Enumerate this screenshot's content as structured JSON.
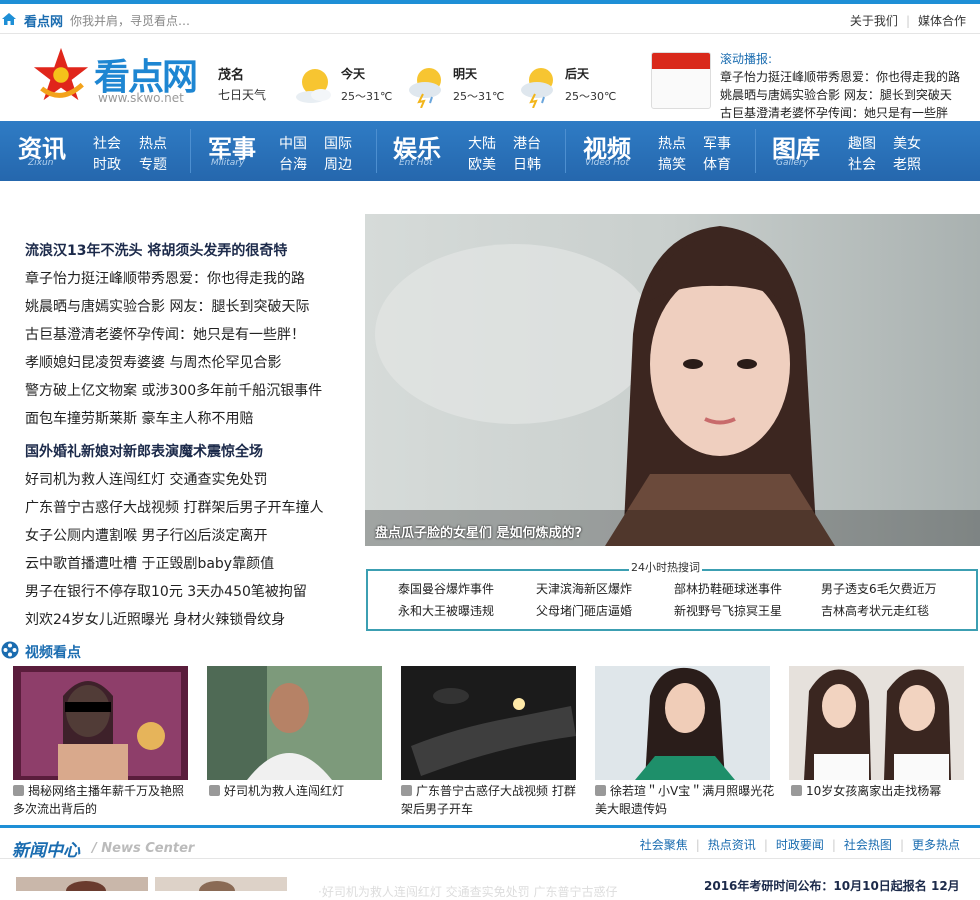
{
  "topbar": {
    "site_name": "看点网",
    "slogan": "你我并肩，寻觅看点…",
    "about": "关于我们",
    "media": "媒体合作"
  },
  "header": {
    "logo_text": "看点网",
    "logo_url": "www.skwo.net",
    "city": "茂名",
    "city_sub": "七日天气",
    "weather": [
      {
        "day": "今天",
        "temp": "25～31℃",
        "icon": "sunny-cloud-icon"
      },
      {
        "day": "明天",
        "temp": "25～31℃",
        "icon": "thunder-rain-icon"
      },
      {
        "day": "后天",
        "temp": "25～30℃",
        "icon": "thunder-rain-icon"
      }
    ],
    "scroll_title": "滚动播报:",
    "scroll_items": [
      "章子怡力挺汪峰顺带秀恩爱：你也得走我的路",
      "姚晨晒与唐嫣实验合影 网友：腿长到突破天",
      "古巨基澄清老婆怀孕传闻：她只是有一些胖"
    ]
  },
  "nav": [
    {
      "big": "资讯",
      "en": "Zixun",
      "subs": [
        [
          "社会",
          "热点"
        ],
        [
          "时政",
          "专题"
        ]
      ]
    },
    {
      "big": "军事",
      "en": "Military",
      "subs": [
        [
          "中国",
          "国际"
        ],
        [
          "台海",
          "周边"
        ]
      ]
    },
    {
      "big": "娱乐",
      "en": "Ent Hot",
      "subs": [
        [
          "大陆",
          "港台"
        ],
        [
          "欧美",
          "日韩"
        ]
      ]
    },
    {
      "big": "视频",
      "en": "Video Hot",
      "subs": [
        [
          "热点",
          "军事"
        ],
        [
          "搞笑",
          "体育"
        ]
      ]
    },
    {
      "big": "图库",
      "en": "Gallery",
      "subs": [
        [
          "趣图",
          "美女"
        ],
        [
          "社会",
          "老照"
        ]
      ]
    }
  ],
  "headlines": [
    {
      "text": "流浪汉13年不洗头 将胡须头发弄的很奇特",
      "bold": true
    },
    {
      "text": "章子怡力挺汪峰顺带秀恩爱：你也得走我的路",
      "bold": false
    },
    {
      "text": "姚晨晒与唐嫣实验合影 网友：腿长到突破天际",
      "bold": false
    },
    {
      "text": "古巨基澄清老婆怀孕传闻：她只是有一些胖！",
      "bold": false
    },
    {
      "text": "孝顺媳妇昆凌贺寿婆婆 与周杰伦罕见合影",
      "bold": false
    },
    {
      "text": "警方破上亿文物案 或涉300多年前千船沉银事件",
      "bold": false
    },
    {
      "text": "面包车撞劳斯莱斯 豪车主人称不用赔",
      "bold": false
    },
    {
      "text": "国外婚礼新娘对新郎表演魔术震惊全场",
      "bold": true
    },
    {
      "text": "好司机为救人连闯红灯 交通查实免处罚",
      "bold": false
    },
    {
      "text": "广东普宁古惑仔大战视频 打群架后男子开车撞人",
      "bold": false
    },
    {
      "text": "女子公厕内遭割喉 男子行凶后淡定离开",
      "bold": false
    },
    {
      "text": "云中歌首播遭吐槽 于正毁剧baby靠颜值",
      "bold": false
    },
    {
      "text": "男子在银行不停存取10元 3天办450笔被拘留",
      "bold": false
    },
    {
      "text": "刘欢24岁女儿近照曝光 身材火辣锁骨纹身",
      "bold": false
    }
  ],
  "hero": {
    "caption": "盘点瓜子脸的女星们 是如何炼成的?"
  },
  "hot": {
    "title": "24小时热搜词",
    "rows": [
      [
        "泰国曼谷爆炸事件",
        "天津滨海新区爆炸",
        "部林扔鞋砸球迷事件",
        "男子透支6毛欠费近万"
      ],
      [
        "永和大王被曝违规",
        "父母堵门砸店逼婚",
        "新视野号飞掠冥王星",
        "吉林高考状元走红毯"
      ]
    ]
  },
  "video": {
    "title": "视频看点",
    "items": [
      "揭秘网络主播年薪千万及艳照多次流出背后的",
      "好司机为救人连闯红灯",
      "广东普宁古惑仔大战视频 打群架后男子开车",
      "徐若瑄＂小V宝＂满月照曝光花美大眼遗传妈",
      "10岁女孩离家出走找杨幂"
    ]
  },
  "news": {
    "title": "新闻中心",
    "en": "/ News Center",
    "links": [
      "社会聚焦",
      "热点资讯",
      "时政要闻",
      "社会热图",
      "更多热点"
    ],
    "right_headline": "2016年考研时间公布：10月10日起报名 12月",
    "faint_text": "·好司机为救人连闯红灯 交通查实免处罚 广东普宁古惑仔"
  },
  "colors": {
    "brand_blue": "#1e8fd6",
    "nav_blue": "#2a6fb8",
    "hot_border": "#3c9fb2",
    "title_blue": "#1a6cb0"
  }
}
